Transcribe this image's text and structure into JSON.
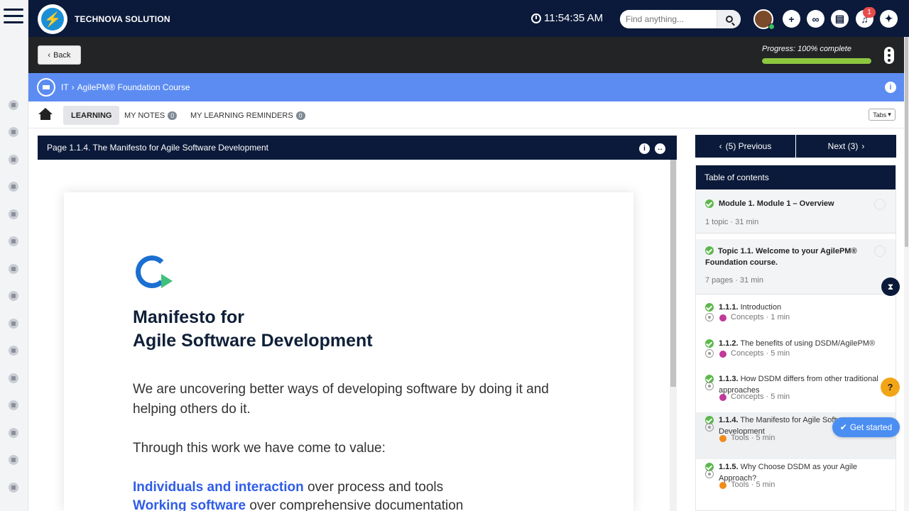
{
  "app": {
    "brand_name": "TECHNOVA SOLUTION",
    "logo_glyph": "⚡",
    "clock": "11:54:35 AM",
    "search_placeholder": "Find anything...",
    "notification_count": "1",
    "accent_color": "#0b1a3a",
    "course_bar_color": "#5c8cf2"
  },
  "subbar": {
    "back_label": "Back",
    "progress_label": "Progress: 100% complete",
    "progress_fraction": 1.0
  },
  "course": {
    "breadcrumb_root": "IT",
    "breadcrumb_course": "AgilePM® Foundation Course"
  },
  "tabs": {
    "learning": "LEARNING",
    "notes": "MY NOTES",
    "notes_count": "0",
    "reminders": "MY LEARNING REMINDERS",
    "reminders_count": "0",
    "tabs_menu": "Tabs"
  },
  "viewer": {
    "page_title": "Page 1.1.4. The Manifesto for Agile Software Development",
    "doc_heading_line1": "Manifesto for",
    "doc_heading_line2": "Agile Software Development",
    "doc_para1": "We are uncovering better ways of developing software by doing it and helping others do it.",
    "doc_para2": "Through this work we have come to value:",
    "value1_hl": "Individuals and interaction",
    "value1_rest": " over process and tools",
    "value2_hl": "Working software",
    "value2_rest": " over comprehensive documentation"
  },
  "toc": {
    "prev_label": "(5) Previous",
    "next_label": "Next (3)",
    "header": "Table of contents",
    "module_title": "Module 1. Module 1 – Overview",
    "module_meta": "1 topic  ·  31 min",
    "topic_title": "Topic 1.1. Welcome to your AgilePM® Foundation course.",
    "topic_meta": "7 pages  ·  31 min",
    "items": [
      {
        "num": "1.1.1.",
        "title": " Introduction",
        "category": "Concepts",
        "duration": "1 min",
        "color": "#c0399b"
      },
      {
        "num": "1.1.2.",
        "title": " The benefits of using DSDM/AgilePM®",
        "category": "Concepts",
        "duration": "5 min",
        "color": "#c0399b"
      },
      {
        "num": "1.1.3.",
        "title": " How DSDM differs from other traditional approaches",
        "category": "Concepts",
        "duration": "5 min",
        "color": "#c0399b"
      },
      {
        "num": "1.1.4.",
        "title": " The Manifesto for Agile Software Development",
        "category": "Tools",
        "duration": "5 min",
        "color": "#f08c1a"
      },
      {
        "num": "1.1.5.",
        "title": " Why Choose DSDM as your Agile Approach?",
        "category": "Tools",
        "duration": "5 min",
        "color": "#f08c1a"
      }
    ]
  },
  "widgets": {
    "get_started": "Get started",
    "help": "?",
    "hourglass": "⧗"
  }
}
